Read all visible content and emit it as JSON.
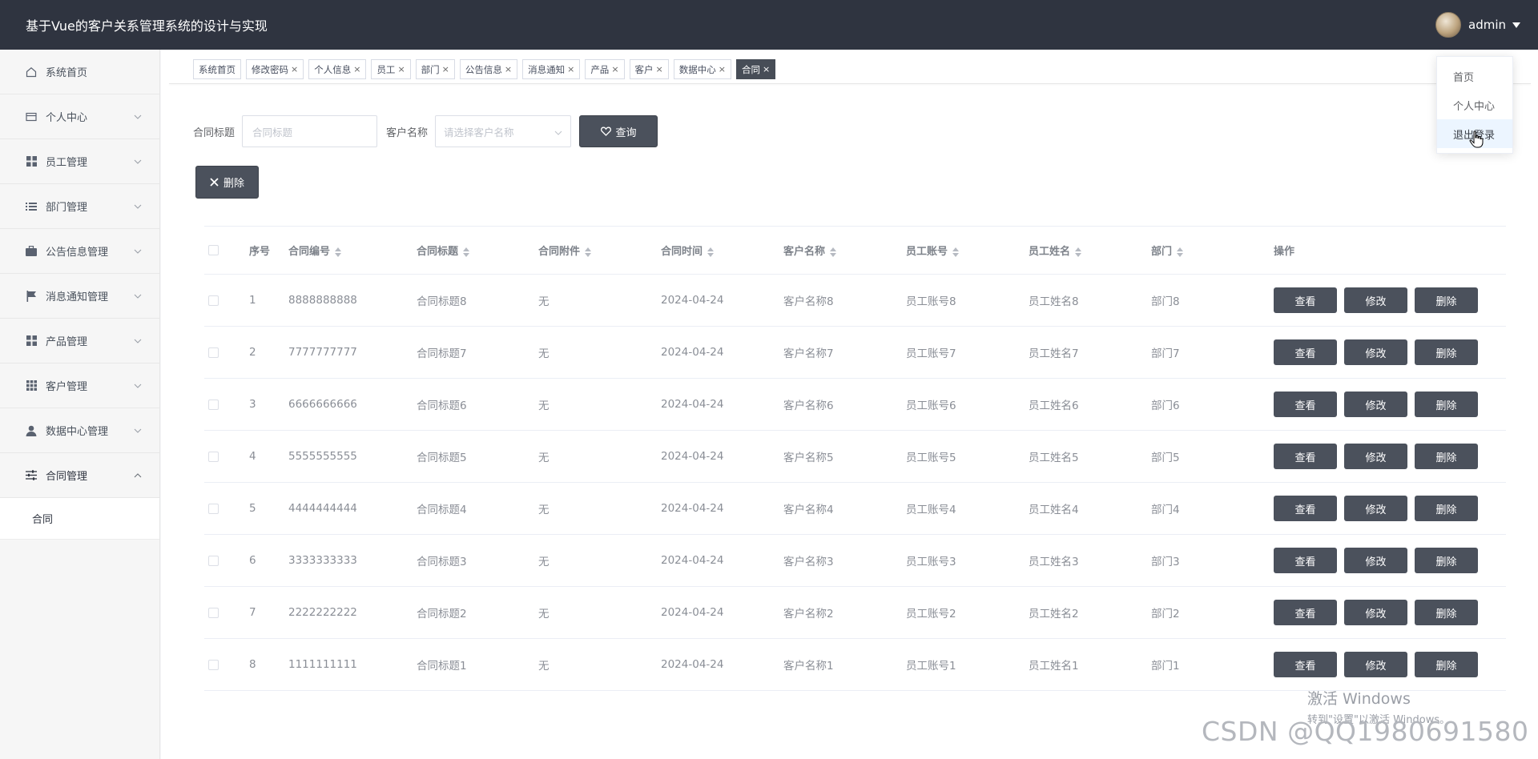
{
  "header": {
    "title": "基于Vue的客户关系管理系统的设计与实现",
    "username": "admin"
  },
  "sidebar": {
    "items": [
      {
        "label": "系统首页",
        "icon": "home-icon",
        "has_children": false
      },
      {
        "label": "个人中心",
        "icon": "card-icon",
        "has_children": true
      },
      {
        "label": "员工管理",
        "icon": "grid-icon",
        "has_children": true
      },
      {
        "label": "部门管理",
        "icon": "list-icon",
        "has_children": true
      },
      {
        "label": "公告信息管理",
        "icon": "briefcase-icon",
        "has_children": true
      },
      {
        "label": "消息通知管理",
        "icon": "flag-icon",
        "has_children": true
      },
      {
        "label": "产品管理",
        "icon": "grid-icon",
        "has_children": true
      },
      {
        "label": "客户管理",
        "icon": "apps-icon",
        "has_children": true
      },
      {
        "label": "数据中心管理",
        "icon": "user-icon",
        "has_children": true
      },
      {
        "label": "合同管理",
        "icon": "sliders-icon",
        "has_children": true,
        "expanded": true
      }
    ],
    "active_submenu": "合同"
  },
  "tags": [
    {
      "label": "系统首页",
      "closable": false
    },
    {
      "label": "修改密码",
      "closable": true
    },
    {
      "label": "个人信息",
      "closable": true
    },
    {
      "label": "员工",
      "closable": true
    },
    {
      "label": "部门",
      "closable": true
    },
    {
      "label": "公告信息",
      "closable": true
    },
    {
      "label": "消息通知",
      "closable": true
    },
    {
      "label": "产品",
      "closable": true
    },
    {
      "label": "客户",
      "closable": true
    },
    {
      "label": "数据中心",
      "closable": true
    },
    {
      "label": "合同",
      "closable": true,
      "active": true
    }
  ],
  "filter": {
    "title_label": "合同标题",
    "title_placeholder": "合同标题",
    "customer_label": "客户名称",
    "customer_placeholder": "请选择客户名称",
    "query_button": "查询",
    "delete_button": "删除"
  },
  "table": {
    "columns": [
      "序号",
      "合同编号",
      "合同标题",
      "合同附件",
      "合同时间",
      "客户名称",
      "员工账号",
      "员工姓名",
      "部门",
      "操作"
    ],
    "sortable": [
      false,
      true,
      true,
      true,
      true,
      true,
      true,
      true,
      true,
      false
    ],
    "actions": [
      "查看",
      "修改",
      "删除"
    ],
    "rows": [
      {
        "idx": "1",
        "no": "8888888888",
        "title": "合同标题8",
        "attachment": "无",
        "time": "2024-04-24",
        "customer": "客户名称8",
        "account": "员工账号8",
        "name": "员工姓名8",
        "dept": "部门8"
      },
      {
        "idx": "2",
        "no": "7777777777",
        "title": "合同标题7",
        "attachment": "无",
        "time": "2024-04-24",
        "customer": "客户名称7",
        "account": "员工账号7",
        "name": "员工姓名7",
        "dept": "部门7"
      },
      {
        "idx": "3",
        "no": "6666666666",
        "title": "合同标题6",
        "attachment": "无",
        "time": "2024-04-24",
        "customer": "客户名称6",
        "account": "员工账号6",
        "name": "员工姓名6",
        "dept": "部门6"
      },
      {
        "idx": "4",
        "no": "5555555555",
        "title": "合同标题5",
        "attachment": "无",
        "time": "2024-04-24",
        "customer": "客户名称5",
        "account": "员工账号5",
        "name": "员工姓名5",
        "dept": "部门5"
      },
      {
        "idx": "5",
        "no": "4444444444",
        "title": "合同标题4",
        "attachment": "无",
        "time": "2024-04-24",
        "customer": "客户名称4",
        "account": "员工账号4",
        "name": "员工姓名4",
        "dept": "部门4"
      },
      {
        "idx": "6",
        "no": "3333333333",
        "title": "合同标题3",
        "attachment": "无",
        "time": "2024-04-24",
        "customer": "客户名称3",
        "account": "员工账号3",
        "name": "员工姓名3",
        "dept": "部门3"
      },
      {
        "idx": "7",
        "no": "2222222222",
        "title": "合同标题2",
        "attachment": "无",
        "time": "2024-04-24",
        "customer": "客户名称2",
        "account": "员工账号2",
        "name": "员工姓名2",
        "dept": "部门2"
      },
      {
        "idx": "8",
        "no": "1111111111",
        "title": "合同标题1",
        "attachment": "无",
        "time": "2024-04-24",
        "customer": "客户名称1",
        "account": "员工账号1",
        "name": "员工姓名1",
        "dept": "部门1"
      }
    ]
  },
  "user_dropdown": {
    "items": [
      "首页",
      "个人中心",
      "退出登录"
    ],
    "hovered": "退出登录"
  },
  "watermarks": {
    "windows_line1": "激活 Windows",
    "windows_line2": "转到\"设置\"以激活 Windows。",
    "csdn": "CSDN @QQ1980691580"
  },
  "colors": {
    "header_bg": "#2f3440",
    "button_dark": "#4b515c",
    "sidebar_bg": "#f6f6f6",
    "dropdown_hover": "#ecf5ff"
  }
}
